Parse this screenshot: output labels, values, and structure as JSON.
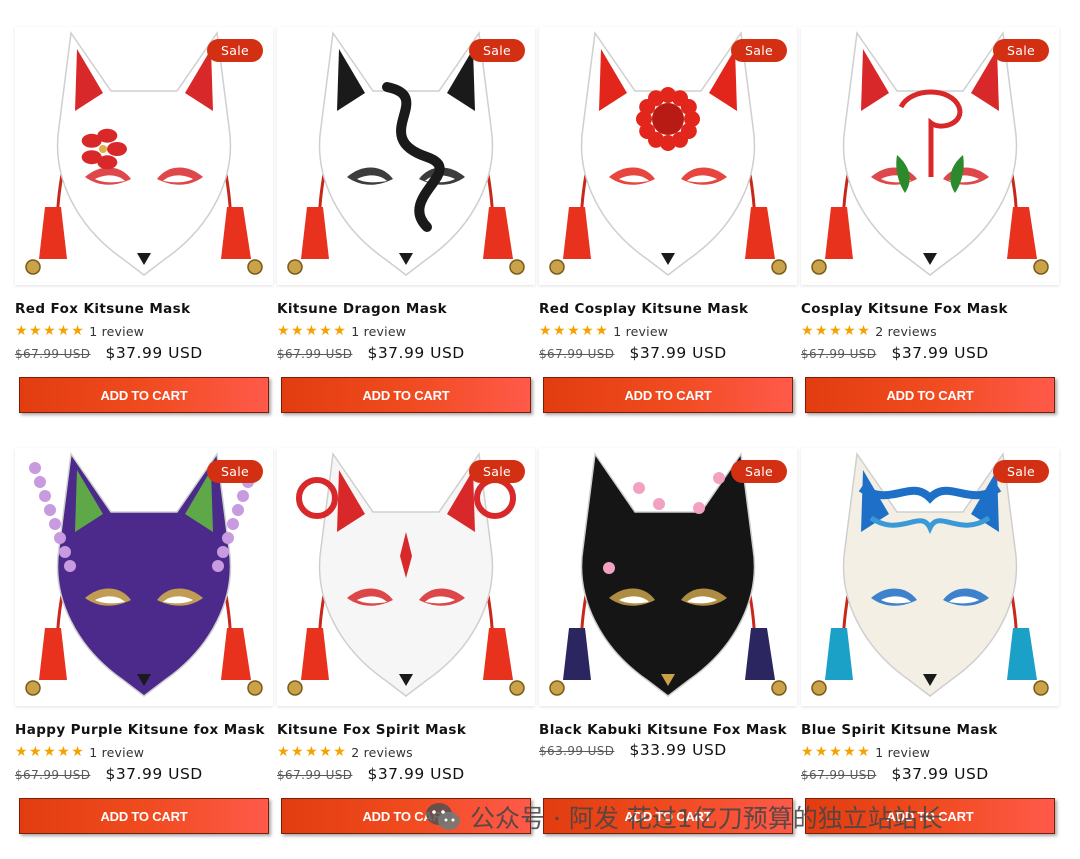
{
  "currency": "USD",
  "products": [
    {
      "title": "Red Fox Kitsune Mask",
      "badge": "Sale",
      "stars": "★★★★★",
      "reviews": "1 review",
      "compare_price": "$67.99 USD",
      "price": "$37.99 USD",
      "cta": "ADD TO CART",
      "image": "red-fox-kitsune-mask-image",
      "theme": {
        "main": "#ffffff",
        "accent": "#d8282a",
        "ear": "#d8282a",
        "tassel": "#e8321e",
        "pattern": "flower"
      }
    },
    {
      "title": "Kitsune Dragon Mask",
      "badge": "Sale",
      "stars": "★★★★★",
      "reviews": "1 review",
      "compare_price": "$67.99 USD",
      "price": "$37.99 USD",
      "cta": "ADD TO CART",
      "image": "kitsune-dragon-mask-image",
      "theme": {
        "main": "#ffffff",
        "accent": "#1a1a1a",
        "ear": "#1a1a1a",
        "tassel": "#e8321e",
        "pattern": "dragon"
      }
    },
    {
      "title": "Red Cosplay Kitsune Mask",
      "badge": "Sale",
      "stars": "★★★★★",
      "reviews": "1 review",
      "compare_price": "$67.99 USD",
      "price": "$37.99 USD",
      "cta": "ADD TO CART",
      "image": "red-cosplay-kitsune-mask-image",
      "theme": {
        "main": "#ffffff",
        "accent": "#e2261c",
        "ear": "#e2261c",
        "tassel": "#e8321e",
        "pattern": "sun"
      }
    },
    {
      "title": "Cosplay Kitsune Fox Mask",
      "badge": "Sale",
      "stars": "★★★★★",
      "reviews": "2 reviews",
      "compare_price": "$67.99 USD",
      "price": "$37.99 USD",
      "cta": "ADD TO CART",
      "image": "cosplay-kitsune-fox-mask-image",
      "theme": {
        "main": "#ffffff",
        "accent": "#d8282a",
        "ear": "#d8282a",
        "tassel": "#e8321e",
        "pattern": "swirl"
      }
    },
    {
      "title": "Happy Purple Kitsune fox Mask",
      "badge": "Sale",
      "stars": "★★★★★",
      "reviews": "1 review",
      "compare_price": "$67.99 USD",
      "price": "$37.99 USD",
      "cta": "ADD TO CART",
      "image": "happy-purple-kitsune-fox-mask-image",
      "theme": {
        "main": "#4b2a8c",
        "accent": "#d6b24a",
        "ear": "#5fa84a",
        "tassel": "#e8321e",
        "pattern": "wisteria"
      }
    },
    {
      "title": "Kitsune Fox Spirit Mask",
      "badge": "Sale",
      "stars": "★★★★★",
      "reviews": "2 reviews",
      "compare_price": "$67.99 USD",
      "price": "$37.99 USD",
      "cta": "ADD TO CART",
      "image": "kitsune-fox-spirit-mask-image",
      "theme": {
        "main": "#f6f6f6",
        "accent": "#d8282a",
        "ear": "#d8282a",
        "tassel": "#e8321e",
        "pattern": "spirit"
      }
    },
    {
      "title": "Black Kabuki Kitsune Fox Mask",
      "badge": "Sale",
      "stars": "",
      "reviews": "",
      "compare_price": "$63.99 USD",
      "price": "$33.99 USD",
      "cta": "ADD TO CART",
      "image": "black-kabuki-kitsune-fox-mask-image",
      "theme": {
        "main": "#151515",
        "accent": "#c9a24a",
        "ear": "#151515",
        "tassel": "#2b2660",
        "pattern": "sakura"
      }
    },
    {
      "title": "Blue Spirit Kitsune Mask",
      "badge": "Sale",
      "stars": "★★★★★",
      "reviews": "1 review",
      "compare_price": "$67.99 USD",
      "price": "$37.99 USD",
      "cta": "ADD TO CART",
      "image": "blue-spirit-kitsune-mask-image",
      "theme": {
        "main": "#f4efe4",
        "accent": "#1e6fc8",
        "ear": "#1e6fc8",
        "tassel": "#1ba0c8",
        "pattern": "wave"
      }
    }
  ],
  "watermark": {
    "text": "公众号 · 阿发 花过1亿刀预算的独立站站长",
    "icon": "wechat-icon"
  }
}
